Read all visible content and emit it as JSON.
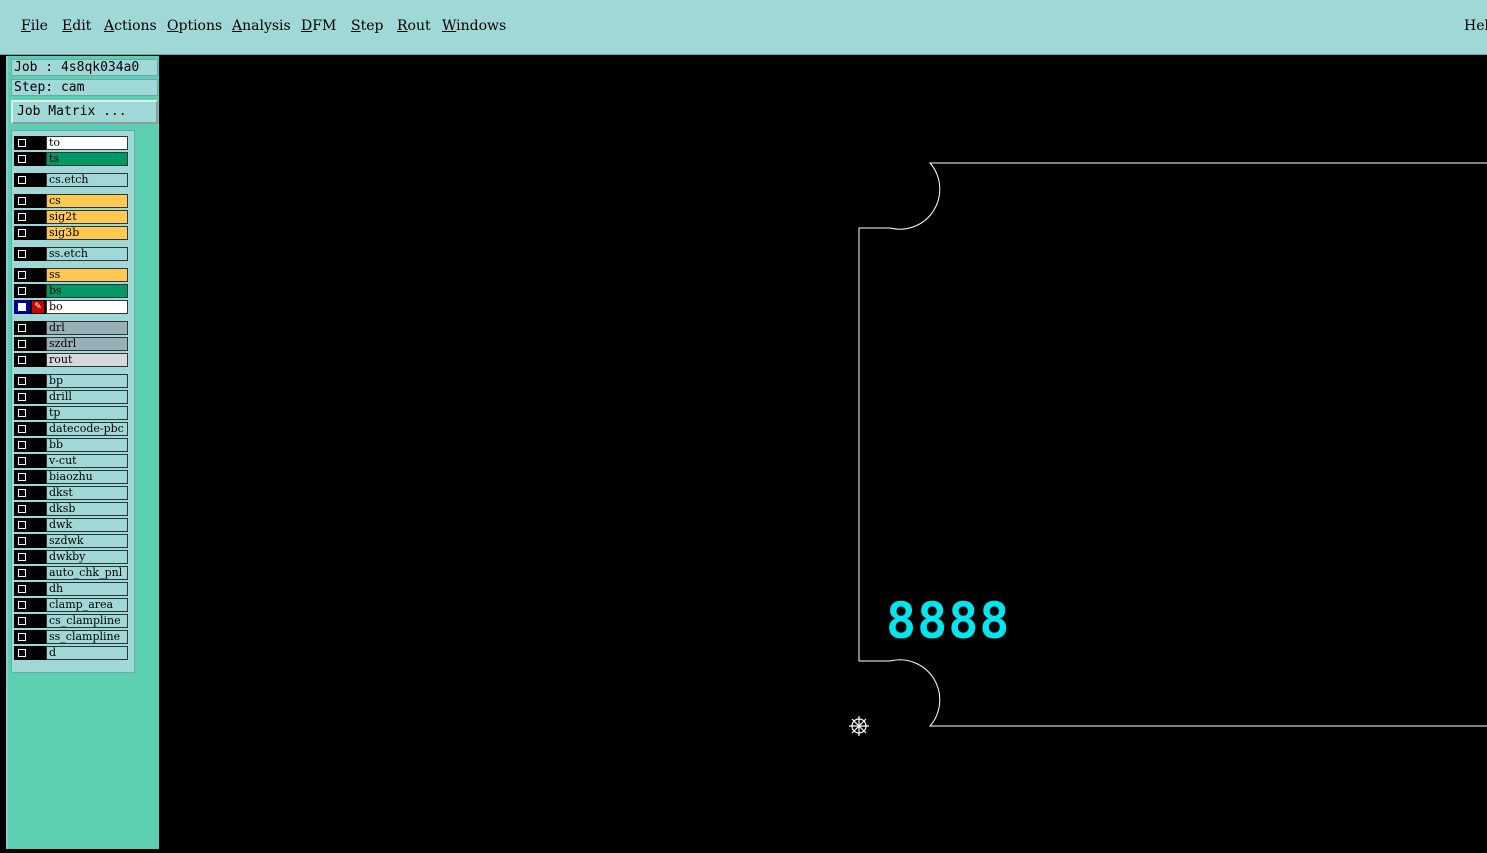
{
  "menu": {
    "file": {
      "ul": "F",
      "rest": "ile"
    },
    "edit": {
      "ul": "E",
      "rest": "dit"
    },
    "actions": {
      "ul": "A",
      "rest": "ctions"
    },
    "options": {
      "ul": "O",
      "rest": "ptions"
    },
    "analysis": {
      "ul": "A",
      "rest": "nalysis"
    },
    "dfm": {
      "ul": "D",
      "rest": "FM"
    },
    "step": {
      "ul": "S",
      "rest": "tep"
    },
    "rout": {
      "ul": "R",
      "rest": "out"
    },
    "windows": {
      "ul": "W",
      "rest": "indows"
    },
    "help": "Hel"
  },
  "sidebar": {
    "job": "Job : 4s8qk034a0",
    "step": "Step: cam",
    "job_matrix": "Job Matrix ..."
  },
  "layers": [
    {
      "name": "to",
      "color": "#ffffff"
    },
    {
      "name": "ts",
      "color": "#009966"
    },
    {
      "name": "cs.etch",
      "color": "#a0d8d8"
    },
    {
      "name": "cs",
      "color": "#ffc850"
    },
    {
      "name": "sig2t",
      "color": "#ffc850"
    },
    {
      "name": "sig3b",
      "color": "#ffc850"
    },
    {
      "name": "ss.etch",
      "color": "#a0d8d8"
    },
    {
      "name": "ss",
      "color": "#ffc850"
    },
    {
      "name": "bs",
      "color": "#009966"
    },
    {
      "name": "bo",
      "color": "#ffffff"
    },
    {
      "name": "drl",
      "color": "#9ab0b8"
    },
    {
      "name": "szdrl",
      "color": "#9ab0b8"
    },
    {
      "name": "rout",
      "color": "#d8d8d8"
    },
    {
      "name": "bp",
      "color": "#a0d8d8"
    },
    {
      "name": "drill",
      "color": "#a0d8d8"
    },
    {
      "name": "tp",
      "color": "#a0d8d8"
    },
    {
      "name": "datecode-pbc",
      "color": "#a0d8d8"
    },
    {
      "name": "bb",
      "color": "#a0d8d8"
    },
    {
      "name": "v-cut",
      "color": "#a0d8d8"
    },
    {
      "name": "biaozhu",
      "color": "#a0d8d8"
    },
    {
      "name": "dkst",
      "color": "#a0d8d8"
    },
    {
      "name": "dksb",
      "color": "#a0d8d8"
    },
    {
      "name": "dwk",
      "color": "#a0d8d8"
    },
    {
      "name": "szdwk",
      "color": "#a0d8d8"
    },
    {
      "name": "dwkby",
      "color": "#a0d8d8"
    },
    {
      "name": "auto_chk_pnl",
      "color": "#a0d8d8"
    },
    {
      "name": "dh",
      "color": "#a0d8d8"
    },
    {
      "name": "clamp_area",
      "color": "#a0d8d8"
    },
    {
      "name": "cs_clampline",
      "color": "#a0d8d8"
    },
    {
      "name": "ss_clampline",
      "color": "#a0d8d8"
    },
    {
      "name": "d",
      "color": "#a0d8d8"
    }
  ],
  "active_layer": "bo",
  "canvas": {
    "datecode_text": "8888",
    "datecode_color": "#00e5ee",
    "outline_color": "#ffffff"
  },
  "icons": {
    "edit_layer": "pencil-icon",
    "datum": "datum-crosshair-icon"
  }
}
